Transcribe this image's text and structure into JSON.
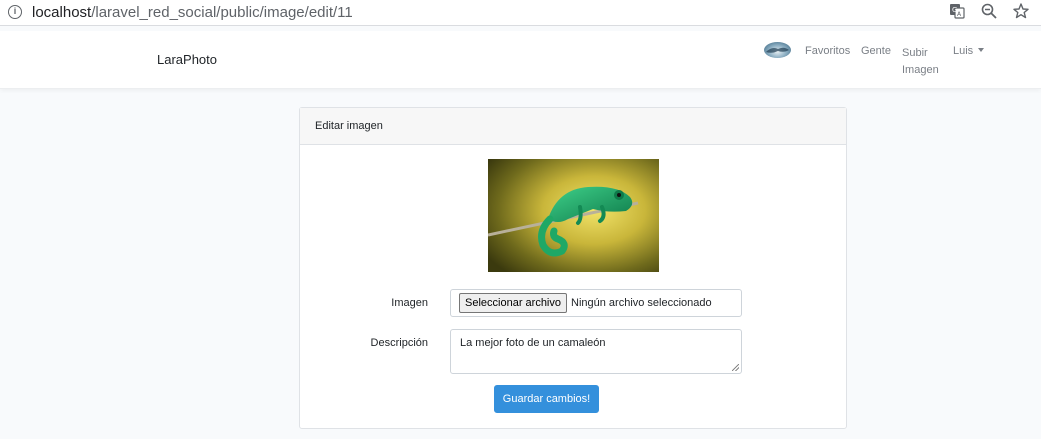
{
  "browser": {
    "url_host": "localhost",
    "url_path": "/laravel_red_social/public/image/edit/11"
  },
  "navbar": {
    "brand": "LaraPhoto",
    "links": {
      "favoritos": "Favoritos",
      "gente": "Gente",
      "subir_imagen": "Subir Imagen",
      "user": "Luis"
    }
  },
  "card": {
    "header": "Editar imagen",
    "form": {
      "image_label": "Imagen",
      "file_button": "Seleccionar archivo",
      "file_status": "Ningún archivo seleccionado",
      "description_label": "Descripción",
      "description_value": "La mejor foto de un camaleón",
      "submit": "Guardar cambios!"
    }
  },
  "colors": {
    "accent": "#3490dc",
    "background": "#f8fafc"
  }
}
